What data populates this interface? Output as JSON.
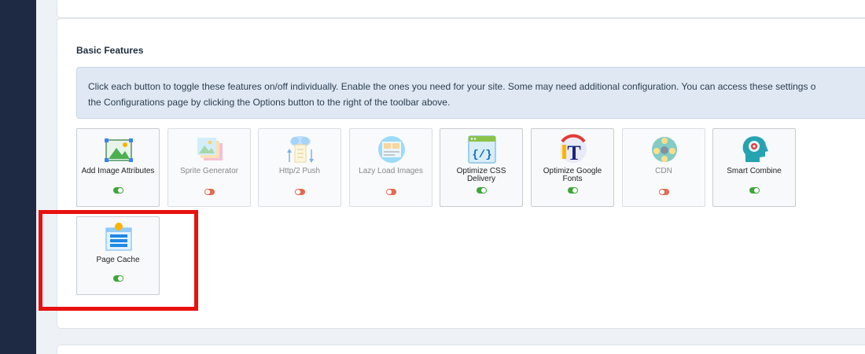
{
  "panel": {
    "title": "Basic Features",
    "info_line1": "Click each button to toggle these features on/off individually. Enable the ones you need for your site. Some may need additional configuration. You can access these settings o",
    "info_line2": "the Configurations page by clicking the Options button to the right of the toolbar above."
  },
  "features": [
    {
      "label": "Add Image Attributes",
      "state": "on",
      "icon": "image-attributes-icon"
    },
    {
      "label": "Sprite Generator",
      "state": "off",
      "icon": "sprite-generator-icon"
    },
    {
      "label": "Http/2 Push",
      "state": "off",
      "icon": "http2-push-icon"
    },
    {
      "label": "Lazy Load Images",
      "state": "off",
      "icon": "lazy-load-icon"
    },
    {
      "label": "Optimize CSS Delivery",
      "state": "on",
      "icon": "css-code-icon"
    },
    {
      "label": "Optimize Google Fonts",
      "state": "on",
      "icon": "font-icon"
    },
    {
      "label": "CDN",
      "state": "off",
      "icon": "cdn-icon"
    },
    {
      "label": "Smart Combine",
      "state": "on",
      "icon": "smart-combine-icon"
    },
    {
      "label": "Page Cache",
      "state": "on",
      "icon": "page-cache-icon"
    }
  ],
  "colors": {
    "toggle_on": "#3ea53a",
    "toggle_off": "#e56a53",
    "highlight": "#e8110f",
    "sidebar": "#1e2a44"
  }
}
